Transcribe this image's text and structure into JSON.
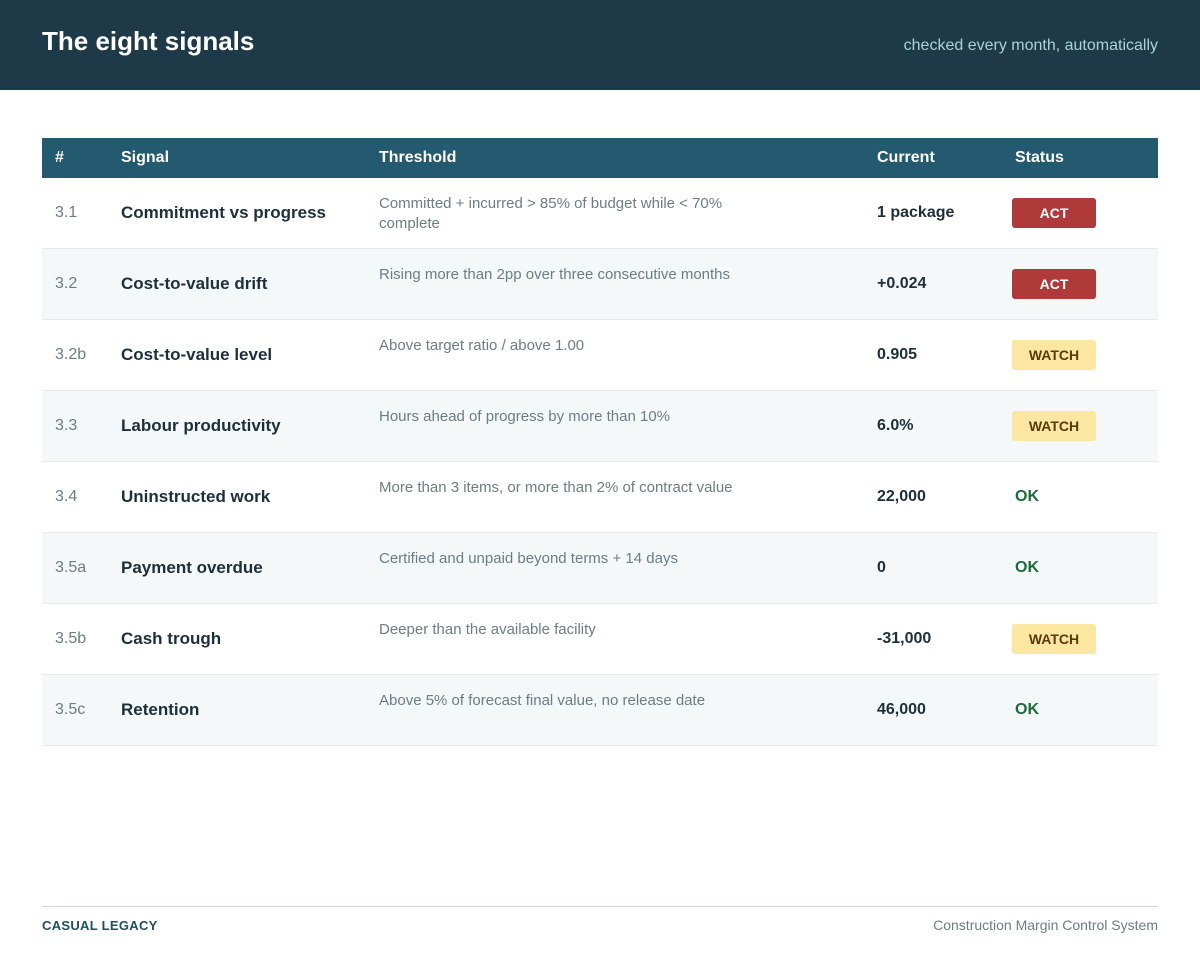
{
  "header": {
    "title": "The eight signals",
    "subtitle": "checked every month, automatically"
  },
  "table": {
    "columns": [
      "#",
      "Signal",
      "Threshold",
      "Current",
      "Status"
    ],
    "rows": [
      {
        "num": "3.1",
        "signal": "Commitment vs progress",
        "threshold": "Committed + incurred > 85% of budget while < 70% complete",
        "current": "1 package",
        "status": "ACT"
      },
      {
        "num": "3.2",
        "signal": "Cost-to-value drift",
        "threshold": "Rising more than 2pp over three consecutive months",
        "current": "+0.024",
        "status": "ACT"
      },
      {
        "num": "3.2b",
        "signal": "Cost-to-value level",
        "threshold": "Above target ratio / above 1.00",
        "current": "0.905",
        "status": "WATCH"
      },
      {
        "num": "3.3",
        "signal": "Labour productivity",
        "threshold": "Hours ahead of progress by more than 10%",
        "current": "6.0%",
        "status": "WATCH"
      },
      {
        "num": "3.4",
        "signal": "Uninstructed work",
        "threshold": "More than 3 items, or more than 2% of contract value",
        "current": "22,000",
        "status": "OK"
      },
      {
        "num": "3.5a",
        "signal": "Payment overdue",
        "threshold": "Certified and unpaid beyond terms + 14 days",
        "current": "0",
        "status": "OK"
      },
      {
        "num": "3.5b",
        "signal": "Cash trough",
        "threshold": "Deeper than the available facility",
        "current": "-31,000",
        "status": "WATCH"
      },
      {
        "num": "3.5c",
        "signal": "Retention",
        "threshold": "Above 5% of forecast final value, no release date",
        "current": "46,000",
        "status": "OK"
      }
    ]
  },
  "footer": {
    "brand": "CASUAL LEGACY",
    "product": "Construction Margin Control System"
  },
  "colors": {
    "header_bg": "#1e3a48",
    "table_head_bg": "#235a70",
    "act": "#b0393a",
    "watch": "#fbe6a2",
    "ok": "#1d6b3c"
  }
}
